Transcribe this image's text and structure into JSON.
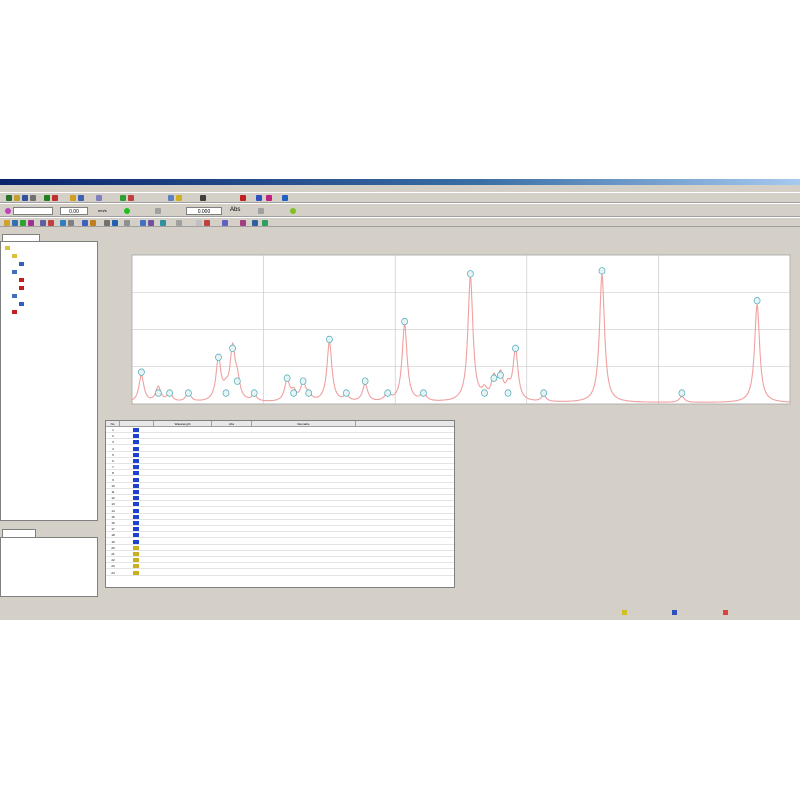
{
  "window": {
    "title": ""
  },
  "menu": [
    "",
    "",
    "",
    "",
    "",
    "",
    "",
    "",
    "",
    "",
    "",
    ""
  ],
  "toolbar2": {
    "value1": "0.00",
    "unit1": "nm/s",
    "value2": "0.000",
    "unit2": "Abs"
  },
  "left_panel": {
    "tab": "",
    "tree": [
      {
        "label": "",
        "color": "#d8c040",
        "indent": 0
      },
      {
        "label": "",
        "color": "#d8c040",
        "indent": 1
      },
      {
        "label": "",
        "color": "#3060c0",
        "indent": 2
      },
      {
        "label": "",
        "color": "#4070c0",
        "indent": 1
      },
      {
        "label": "",
        "color": "#c02020",
        "indent": 2
      },
      {
        "label": "",
        "color": "#c02020",
        "indent": 2
      },
      {
        "label": "",
        "color": "#4070c0",
        "indent": 1
      },
      {
        "label": "",
        "color": "#3060c0",
        "indent": 2
      },
      {
        "label": "",
        "color": "#c02020",
        "indent": 1
      }
    ],
    "bottom_tab": ""
  },
  "chart_data": {
    "type": "line",
    "title": "",
    "xlabel": "",
    "ylabel": "",
    "xlim": [
      400,
      1100
    ],
    "ylim": [
      0,
      0.5
    ],
    "grid": true,
    "x_ticks": [
      "",
      "",
      "",
      "",
      "",
      ""
    ],
    "y_ticks": [
      "",
      "",
      "",
      "",
      ""
    ],
    "series": [
      {
        "color": "#f0a0a0",
        "peaks": [
          {
            "x": 410,
            "y": 0.09
          },
          {
            "x": 428,
            "y": 0.05
          },
          {
            "x": 440,
            "y": 0.03
          },
          {
            "x": 460,
            "y": 0.03
          },
          {
            "x": 492,
            "y": 0.14
          },
          {
            "x": 500,
            "y": 0.03
          },
          {
            "x": 507,
            "y": 0.17
          },
          {
            "x": 512,
            "y": 0.06
          },
          {
            "x": 530,
            "y": 0.02
          },
          {
            "x": 565,
            "y": 0.07
          },
          {
            "x": 572,
            "y": 0.03
          },
          {
            "x": 582,
            "y": 0.06
          },
          {
            "x": 588,
            "y": 0.02
          },
          {
            "x": 610,
            "y": 0.2
          },
          {
            "x": 628,
            "y": 0.02
          },
          {
            "x": 648,
            "y": 0.06
          },
          {
            "x": 672,
            "y": 0.03
          },
          {
            "x": 690,
            "y": 0.26
          },
          {
            "x": 710,
            "y": 0.03
          },
          {
            "x": 760,
            "y": 0.42
          },
          {
            "x": 775,
            "y": 0.03
          },
          {
            "x": 785,
            "y": 0.07
          },
          {
            "x": 792,
            "y": 0.08
          },
          {
            "x": 800,
            "y": 0.04
          },
          {
            "x": 808,
            "y": 0.17
          },
          {
            "x": 838,
            "y": 0.02
          },
          {
            "x": 900,
            "y": 0.43
          },
          {
            "x": 985,
            "y": 0.02
          },
          {
            "x": 1065,
            "y": 0.33
          }
        ]
      }
    ]
  },
  "grid_table": {
    "columns": [
      "No",
      "",
      "Wavelength",
      "Abs",
      "Remarks"
    ],
    "rows": [
      {
        "no": "1",
        "wl": "",
        "abs": "",
        "mark": "blue"
      },
      {
        "no": "2",
        "wl": "",
        "abs": "",
        "mark": "blue"
      },
      {
        "no": "3",
        "wl": "",
        "abs": "",
        "mark": "blue"
      },
      {
        "no": "4",
        "wl": "",
        "abs": "",
        "mark": "blue"
      },
      {
        "no": "5",
        "wl": "",
        "abs": "",
        "mark": "blue"
      },
      {
        "no": "6",
        "wl": "",
        "abs": "",
        "mark": "blue"
      },
      {
        "no": "7",
        "wl": "",
        "abs": "",
        "mark": "blue"
      },
      {
        "no": "8",
        "wl": "",
        "abs": "",
        "mark": "blue"
      },
      {
        "no": "9",
        "wl": "",
        "abs": "",
        "mark": "blue"
      },
      {
        "no": "10",
        "wl": "",
        "abs": "",
        "mark": "blue"
      },
      {
        "no": "11",
        "wl": "",
        "abs": "",
        "mark": "blue"
      },
      {
        "no": "12",
        "wl": "",
        "abs": "",
        "mark": "blue"
      },
      {
        "no": "13",
        "wl": "",
        "abs": "",
        "mark": "blue"
      },
      {
        "no": "14",
        "wl": "",
        "abs": "",
        "mark": "blue"
      },
      {
        "no": "15",
        "wl": "",
        "abs": "",
        "mark": "blue"
      },
      {
        "no": "16",
        "wl": "",
        "abs": "",
        "mark": "blue"
      },
      {
        "no": "17",
        "wl": "",
        "abs": "",
        "mark": "blue"
      },
      {
        "no": "18",
        "wl": "",
        "abs": "",
        "mark": "blue"
      },
      {
        "no": "19",
        "wl": "",
        "abs": "",
        "mark": "blue"
      },
      {
        "no": "20",
        "wl": "",
        "abs": "",
        "mark": "yellow"
      },
      {
        "no": "21",
        "wl": "",
        "abs": "",
        "mark": "yellow"
      },
      {
        "no": "22",
        "wl": "",
        "abs": "",
        "mark": "yellow"
      },
      {
        "no": "23",
        "wl": "",
        "abs": "",
        "mark": "yellow"
      },
      {
        "no": "24",
        "wl": "",
        "abs": "",
        "mark": "yellow"
      }
    ]
  },
  "status": {
    "legend": [
      {
        "label": "",
        "color": "#d0c020"
      },
      {
        "label": "",
        "color": "#3050c0"
      },
      {
        "label": "",
        "color": "#e04040"
      }
    ]
  },
  "colors": {
    "curve": "#f0a0a0",
    "peak_marker": "#4aa8b8",
    "grid_line": "#c0c0c0"
  }
}
